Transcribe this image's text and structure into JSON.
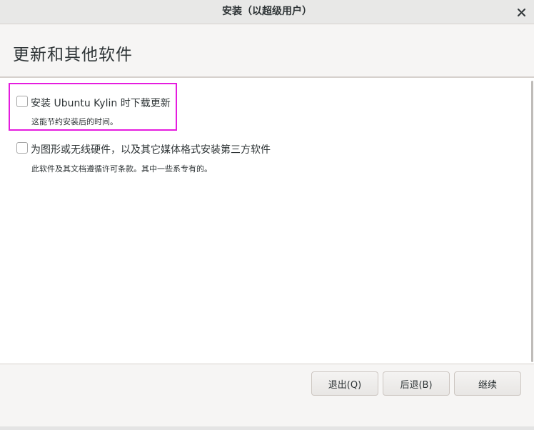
{
  "window": {
    "title": "安装（以超级用户）",
    "close_icon": "close-icon"
  },
  "header": {
    "title": "更新和其他软件"
  },
  "options": [
    {
      "label": "安装 Ubuntu Kylin 时下载更新",
      "description": "这能节约安装后的时间。",
      "checked": false
    },
    {
      "label": "为图形或无线硬件，以及其它媒体格式安装第三方软件",
      "description": "此软件及其文档遵循许可条款。其中一些系专有的。",
      "checked": false
    }
  ],
  "buttons": {
    "quit": "退出(Q)",
    "back": "后退(B)",
    "continue": "继续"
  },
  "colors": {
    "focus_highlight": "#e51cdf"
  }
}
